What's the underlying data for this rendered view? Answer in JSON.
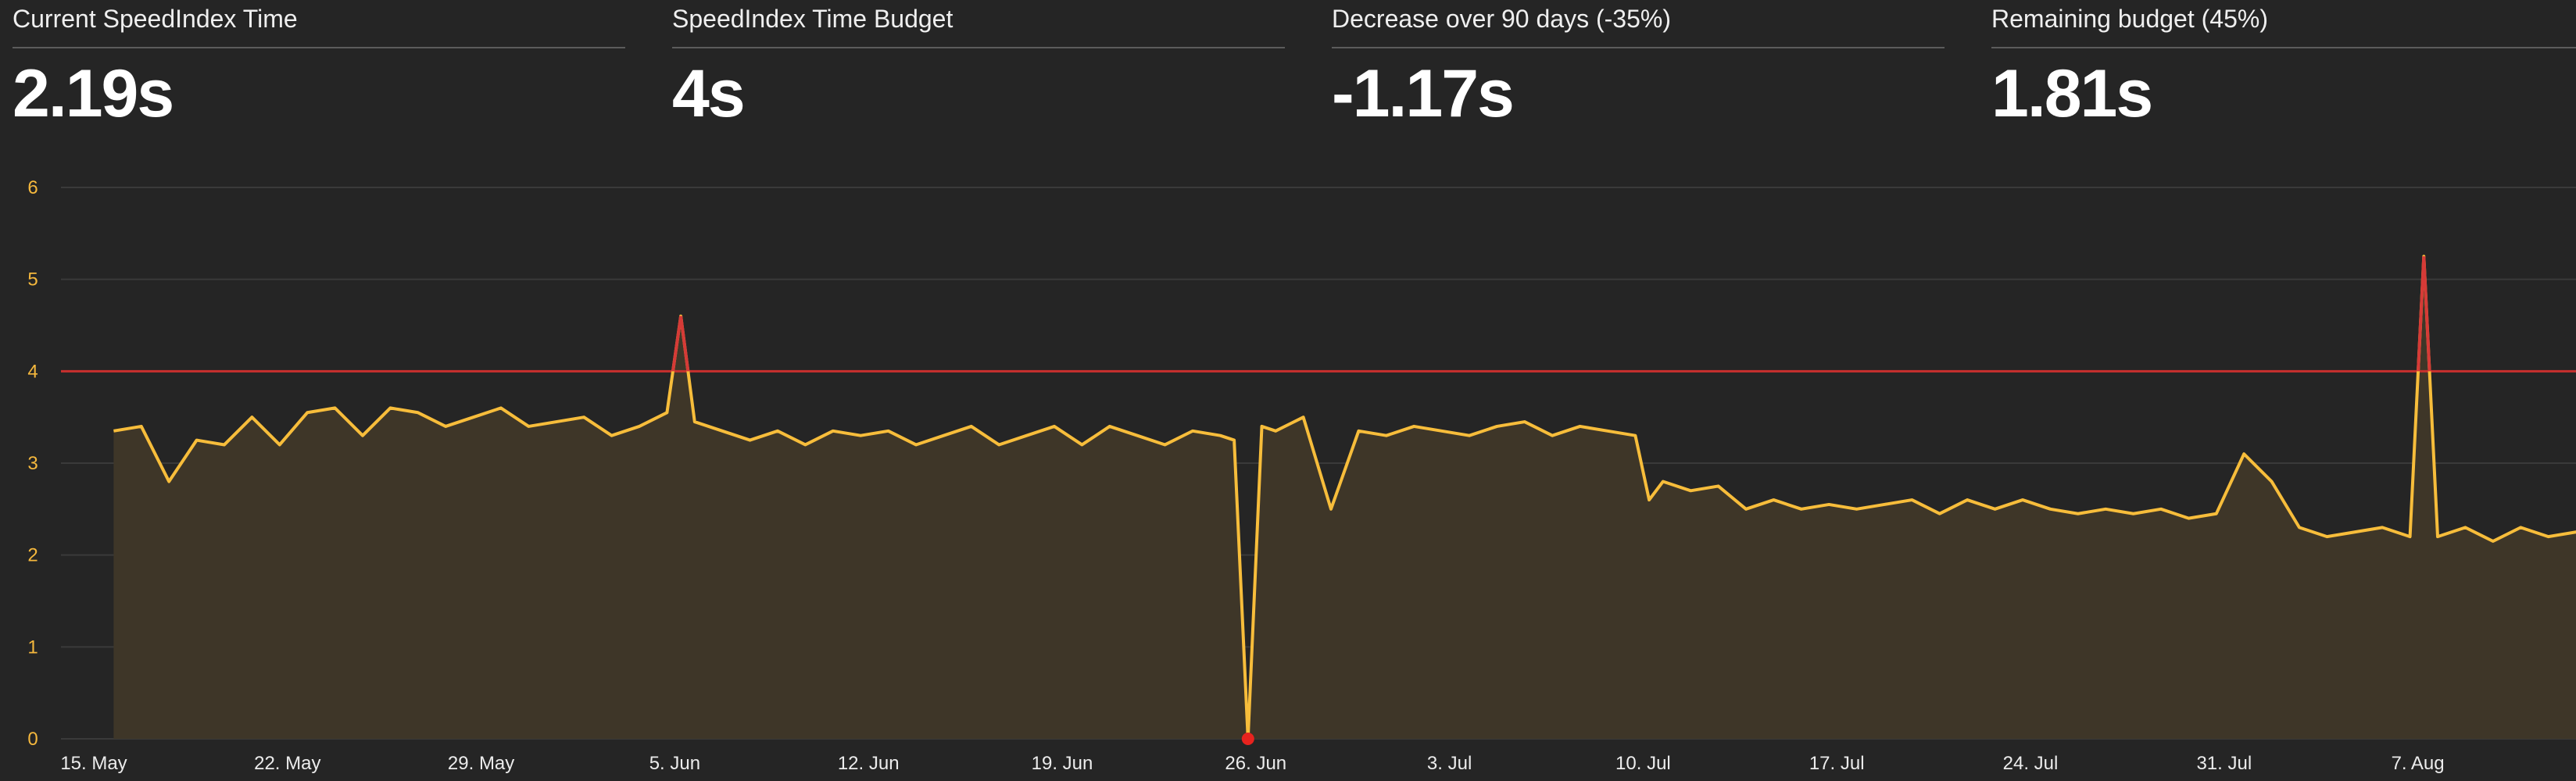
{
  "stats": [
    {
      "label": "Current SpeedIndex Time",
      "value": "2.19s"
    },
    {
      "label": "SpeedIndex Time Budget",
      "value": "4s"
    },
    {
      "label": "Decrease over 90 days (-35%)",
      "value": "-1.17s"
    },
    {
      "label": "Remaining budget (45%)",
      "value": "1.81s"
    }
  ],
  "colors": {
    "background": "#252525",
    "line": "#f7bd3b",
    "area": "#3e3628",
    "budget": "#c8302e",
    "over_budget": "#d63a37",
    "gridline": "#3a3a3a",
    "ytick": "#f5b83d",
    "xtick": "#ececec"
  },
  "chart_data": {
    "type": "area",
    "title": "",
    "xlabel": "",
    "ylabel": "",
    "x_domain": [
      "2019-05-15",
      "2019-08-14"
    ],
    "ylim": [
      0,
      6
    ],
    "yticks": [
      "0",
      "1",
      "2",
      "3",
      "4",
      "5",
      "6"
    ],
    "xticks": [
      {
        "date": "2019-05-15",
        "label": "15. May"
      },
      {
        "date": "2019-05-22",
        "label": "22. May"
      },
      {
        "date": "2019-05-29",
        "label": "29. May"
      },
      {
        "date": "2019-06-05",
        "label": "5. Jun"
      },
      {
        "date": "2019-06-12",
        "label": "12. Jun"
      },
      {
        "date": "2019-06-19",
        "label": "19. Jun"
      },
      {
        "date": "2019-06-26",
        "label": "26. Jun"
      },
      {
        "date": "2019-07-03",
        "label": "3. Jul"
      },
      {
        "date": "2019-07-10",
        "label": "10. Jul"
      },
      {
        "date": "2019-07-17",
        "label": "17. Jul"
      },
      {
        "date": "2019-07-24",
        "label": "24. Jul"
      },
      {
        "date": "2019-07-31",
        "label": "31. Jul"
      },
      {
        "date": "2019-08-07",
        "label": "7. Aug"
      }
    ],
    "budget_line": 4,
    "grid": true,
    "legend": "none",
    "series": [
      {
        "values": [
          [
            "2019-05-16",
            3.35
          ],
          [
            "2019-05-17",
            3.4
          ],
          [
            "2019-05-18",
            2.8
          ],
          [
            "2019-05-19",
            3.25
          ],
          [
            "2019-05-20",
            3.2
          ],
          [
            "2019-05-21",
            3.5
          ],
          [
            "2019-05-22",
            3.2
          ],
          [
            "2019-05-23",
            3.55
          ],
          [
            "2019-05-24",
            3.6
          ],
          [
            "2019-05-25",
            3.3
          ],
          [
            "2019-05-26",
            3.6
          ],
          [
            "2019-05-27",
            3.55
          ],
          [
            "2019-05-28",
            3.4
          ],
          [
            "2019-05-29",
            3.5
          ],
          [
            "2019-05-30",
            3.6
          ],
          [
            "2019-05-31",
            3.4
          ],
          [
            "2019-06-01",
            3.45
          ],
          [
            "2019-06-02",
            3.5
          ],
          [
            "2019-06-03",
            3.3
          ],
          [
            "2019-06-04",
            3.4
          ],
          [
            "2019-06-05",
            3.55
          ],
          [
            "2019-06-05T12:00",
            4.6
          ],
          [
            "2019-06-06",
            3.45
          ],
          [
            "2019-06-07",
            3.35
          ],
          [
            "2019-06-08",
            3.25
          ],
          [
            "2019-06-09",
            3.35
          ],
          [
            "2019-06-10",
            3.2
          ],
          [
            "2019-06-11",
            3.35
          ],
          [
            "2019-06-12",
            3.3
          ],
          [
            "2019-06-13",
            3.35
          ],
          [
            "2019-06-14",
            3.2
          ],
          [
            "2019-06-15",
            3.3
          ],
          [
            "2019-06-16",
            3.4
          ],
          [
            "2019-06-17",
            3.2
          ],
          [
            "2019-06-18",
            3.3
          ],
          [
            "2019-06-19",
            3.4
          ],
          [
            "2019-06-20",
            3.2
          ],
          [
            "2019-06-21",
            3.4
          ],
          [
            "2019-06-22",
            3.3
          ],
          [
            "2019-06-23",
            3.2
          ],
          [
            "2019-06-24",
            3.35
          ],
          [
            "2019-06-25",
            3.3
          ],
          [
            "2019-06-25T12:00",
            3.25
          ],
          [
            "2019-06-26",
            0
          ],
          [
            "2019-06-26T12:00",
            3.4
          ],
          [
            "2019-06-27",
            3.35
          ],
          [
            "2019-06-28",
            3.5
          ],
          [
            "2019-06-29",
            2.5
          ],
          [
            "2019-06-30",
            3.35
          ],
          [
            "2019-07-01",
            3.3
          ],
          [
            "2019-07-02",
            3.4
          ],
          [
            "2019-07-03",
            3.35
          ],
          [
            "2019-07-04",
            3.3
          ],
          [
            "2019-07-05",
            3.4
          ],
          [
            "2019-07-06",
            3.45
          ],
          [
            "2019-07-07",
            3.3
          ],
          [
            "2019-07-08",
            3.4
          ],
          [
            "2019-07-09",
            3.35
          ],
          [
            "2019-07-10",
            3.3
          ],
          [
            "2019-07-10T12:00",
            2.6
          ],
          [
            "2019-07-11",
            2.8
          ],
          [
            "2019-07-12",
            2.7
          ],
          [
            "2019-07-13",
            2.75
          ],
          [
            "2019-07-14",
            2.5
          ],
          [
            "2019-07-15",
            2.6
          ],
          [
            "2019-07-16",
            2.5
          ],
          [
            "2019-07-17",
            2.55
          ],
          [
            "2019-07-18",
            2.5
          ],
          [
            "2019-07-19",
            2.55
          ],
          [
            "2019-07-20",
            2.6
          ],
          [
            "2019-07-21",
            2.45
          ],
          [
            "2019-07-22",
            2.6
          ],
          [
            "2019-07-23",
            2.5
          ],
          [
            "2019-07-24",
            2.6
          ],
          [
            "2019-07-25",
            2.5
          ],
          [
            "2019-07-26",
            2.45
          ],
          [
            "2019-07-27",
            2.5
          ],
          [
            "2019-07-28",
            2.45
          ],
          [
            "2019-07-29",
            2.5
          ],
          [
            "2019-07-30",
            2.4
          ],
          [
            "2019-07-31",
            2.45
          ],
          [
            "2019-08-01",
            3.1
          ],
          [
            "2019-08-02",
            2.8
          ],
          [
            "2019-08-03",
            2.3
          ],
          [
            "2019-08-04",
            2.2
          ],
          [
            "2019-08-05",
            2.25
          ],
          [
            "2019-08-06",
            2.3
          ],
          [
            "2019-08-07",
            2.2
          ],
          [
            "2019-08-07T12:00",
            5.25
          ],
          [
            "2019-08-08",
            2.2
          ],
          [
            "2019-08-09",
            2.3
          ],
          [
            "2019-08-10",
            2.15
          ],
          [
            "2019-08-11",
            2.3
          ],
          [
            "2019-08-12",
            2.2
          ],
          [
            "2019-08-13",
            2.25
          ],
          [
            "2019-08-14",
            2.2
          ]
        ]
      }
    ],
    "markers": [
      {
        "date": "2019-06-26",
        "value": 0
      }
    ]
  }
}
